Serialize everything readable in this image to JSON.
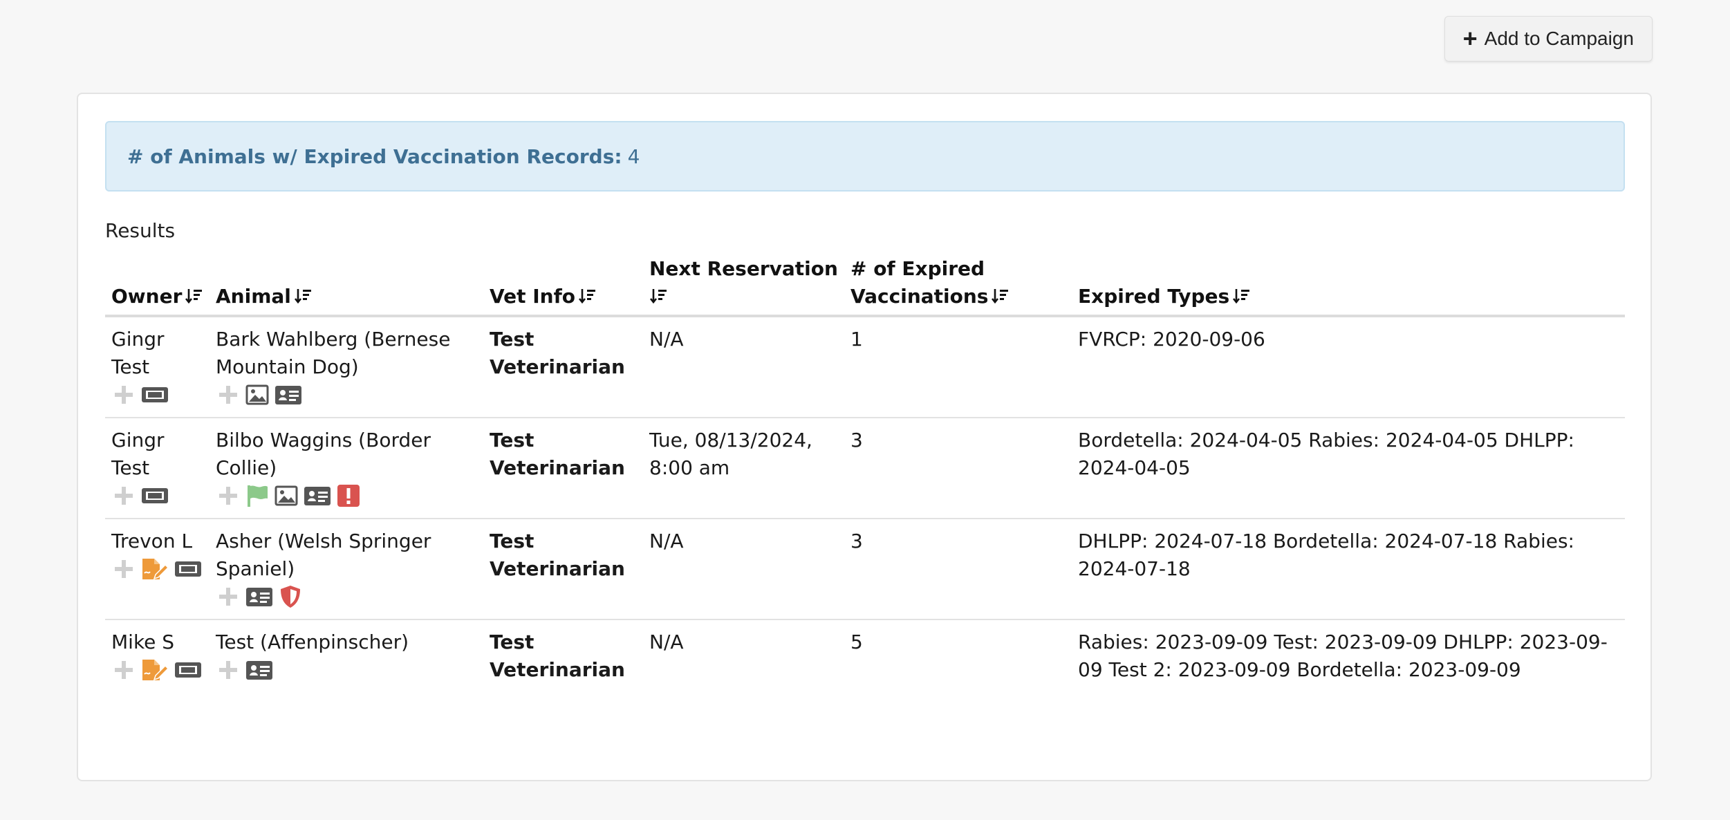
{
  "toolbar": {
    "add_campaign_label": "Add to Campaign"
  },
  "alert": {
    "label": "# of Animals w/ Expired Vaccination Records:",
    "count": "4"
  },
  "results_title": "Results",
  "columns": {
    "owner": "Owner",
    "animal": "Animal",
    "vet": "Vet Info",
    "next_res": "Next Reservation",
    "expired_count": "# of Expired Vaccinations",
    "expired_types": "Expired Types"
  },
  "rows": [
    {
      "owner": "Gingr Test",
      "owner_icons": [
        "plus-icon",
        "ticket-icon"
      ],
      "animal": "Bark Wahlberg (Bernese Mountain Dog)",
      "animal_icons": [
        "plus-icon",
        "image-icon",
        "id-card-icon"
      ],
      "vet": "Test Veterinarian",
      "next_reservation": "N/A",
      "expired_count": "1",
      "expired_types": "FVRCP: 2020-09-06"
    },
    {
      "owner": "Gingr Test",
      "owner_icons": [
        "plus-icon",
        "ticket-icon"
      ],
      "animal": "Bilbo Waggins (Border Collie)",
      "animal_icons": [
        "plus-icon",
        "flag-icon",
        "image-icon",
        "id-card-icon",
        "alert-icon"
      ],
      "vet": "Test Veterinarian",
      "next_reservation": "Tue, 08/13/2024, 8:00 am",
      "expired_count": "3",
      "expired_types": "Bordetella: 2024-04-05 Rabies: 2024-04-05 DHLPP: 2024-04-05"
    },
    {
      "owner": "Trevon L",
      "owner_icons": [
        "plus-icon",
        "signature-icon",
        "ticket-icon"
      ],
      "animal": "Asher (Welsh Springer Spaniel)",
      "animal_icons": [
        "plus-icon",
        "id-card-icon",
        "shield-icon"
      ],
      "vet": "Test Veterinarian",
      "next_reservation": "N/A",
      "expired_count": "3",
      "expired_types": "DHLPP: 2024-07-18 Bordetella: 2024-07-18 Rabies: 2024-07-18"
    },
    {
      "owner": "Mike S",
      "owner_icons": [
        "plus-icon",
        "signature-icon",
        "ticket-icon"
      ],
      "animal": "Test (Affenpinscher)",
      "animal_icons": [
        "plus-icon",
        "id-card-icon"
      ],
      "vet": "Test Veterinarian",
      "next_reservation": "N/A",
      "expired_count": "5",
      "expired_types": "Rabies: 2023-09-09 Test: 2023-09-09 DHLPP: 2023-09-09 Test 2: 2023-09-09 Bordetella: 2023-09-09"
    }
  ],
  "colors": {
    "alert_bg": "#dfeef8",
    "alert_text": "#3e6f93",
    "flag": "#8cc98a",
    "alert_icon": "#d9534f",
    "signature": "#ee9a3a",
    "muted_plus": "#cfcfcf",
    "dark_icon": "#555555"
  }
}
